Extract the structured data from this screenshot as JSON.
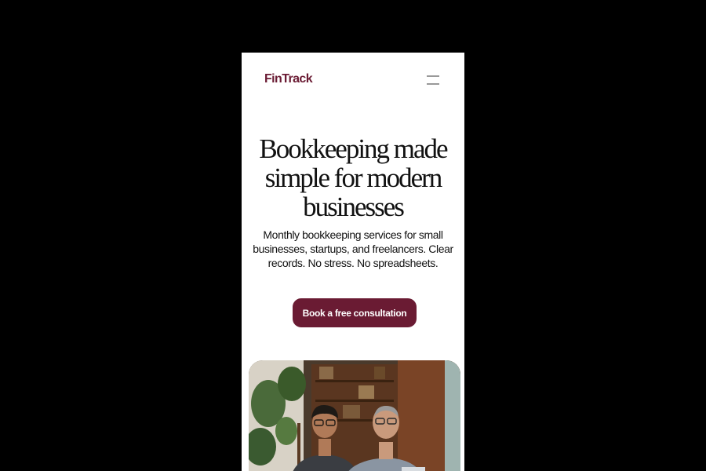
{
  "nav": {
    "logo_text": "FinTrack",
    "menu_icon": "hamburger-menu-icon"
  },
  "hero": {
    "title": "Bookkeeping made simple for modern businesses",
    "subtitle": "Monthly bookkeeping services for small businesses, startups, and freelancers. Clear records. No stress. No spreadsheets.",
    "cta_label": "Book a free consultation"
  },
  "colors": {
    "brand": "#6a1b33",
    "page_background": "#000000",
    "card_background": "#ffffff",
    "text": "#111111"
  }
}
